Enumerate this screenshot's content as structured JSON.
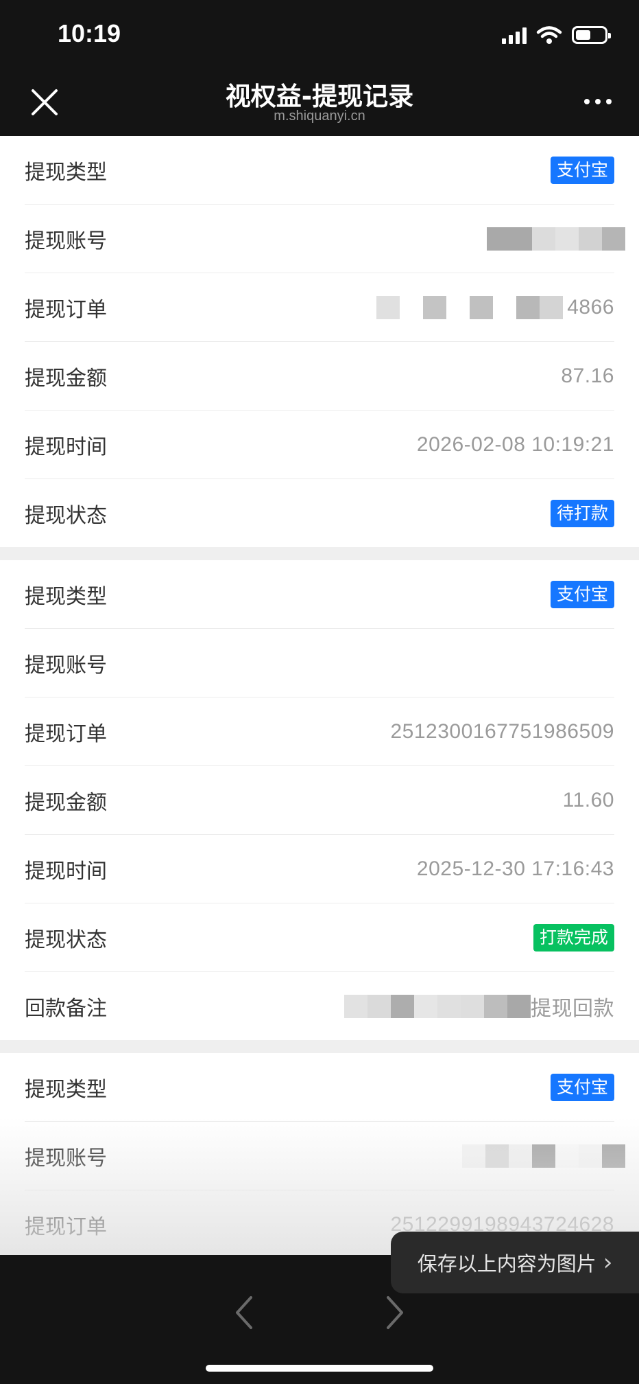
{
  "status_bar": {
    "time": "10:19",
    "battery_level": 0.45
  },
  "nav": {
    "title": "视权益-提现记录",
    "domain": "m.shiquanyi.cn"
  },
  "labels": {
    "type": "提现类型",
    "account": "提现账号",
    "order": "提现订单",
    "amount": "提现金额",
    "time": "提现时间",
    "status": "提现状态",
    "remark": "回款备注"
  },
  "records": [
    {
      "type": "支付宝",
      "account": "",
      "order": "4866",
      "amount": "87.16",
      "time": "2026-02-08 10:19:21",
      "status": "待打款"
    },
    {
      "type": "支付宝",
      "account": "",
      "order": "251230016775198​6509",
      "amount": "11.60",
      "time": "2025-12-30 17:16:43",
      "status": "打款完成",
      "remark": "提现回款"
    },
    {
      "type": "支付宝",
      "account": "",
      "order": "251229919894372​4628"
    }
  ],
  "toast": {
    "text": "保存以上内容为图片",
    "arrow": "›"
  },
  "colors": {
    "badge_blue": "#1677ff",
    "badge_green": "#07c160",
    "background": "#141414"
  }
}
